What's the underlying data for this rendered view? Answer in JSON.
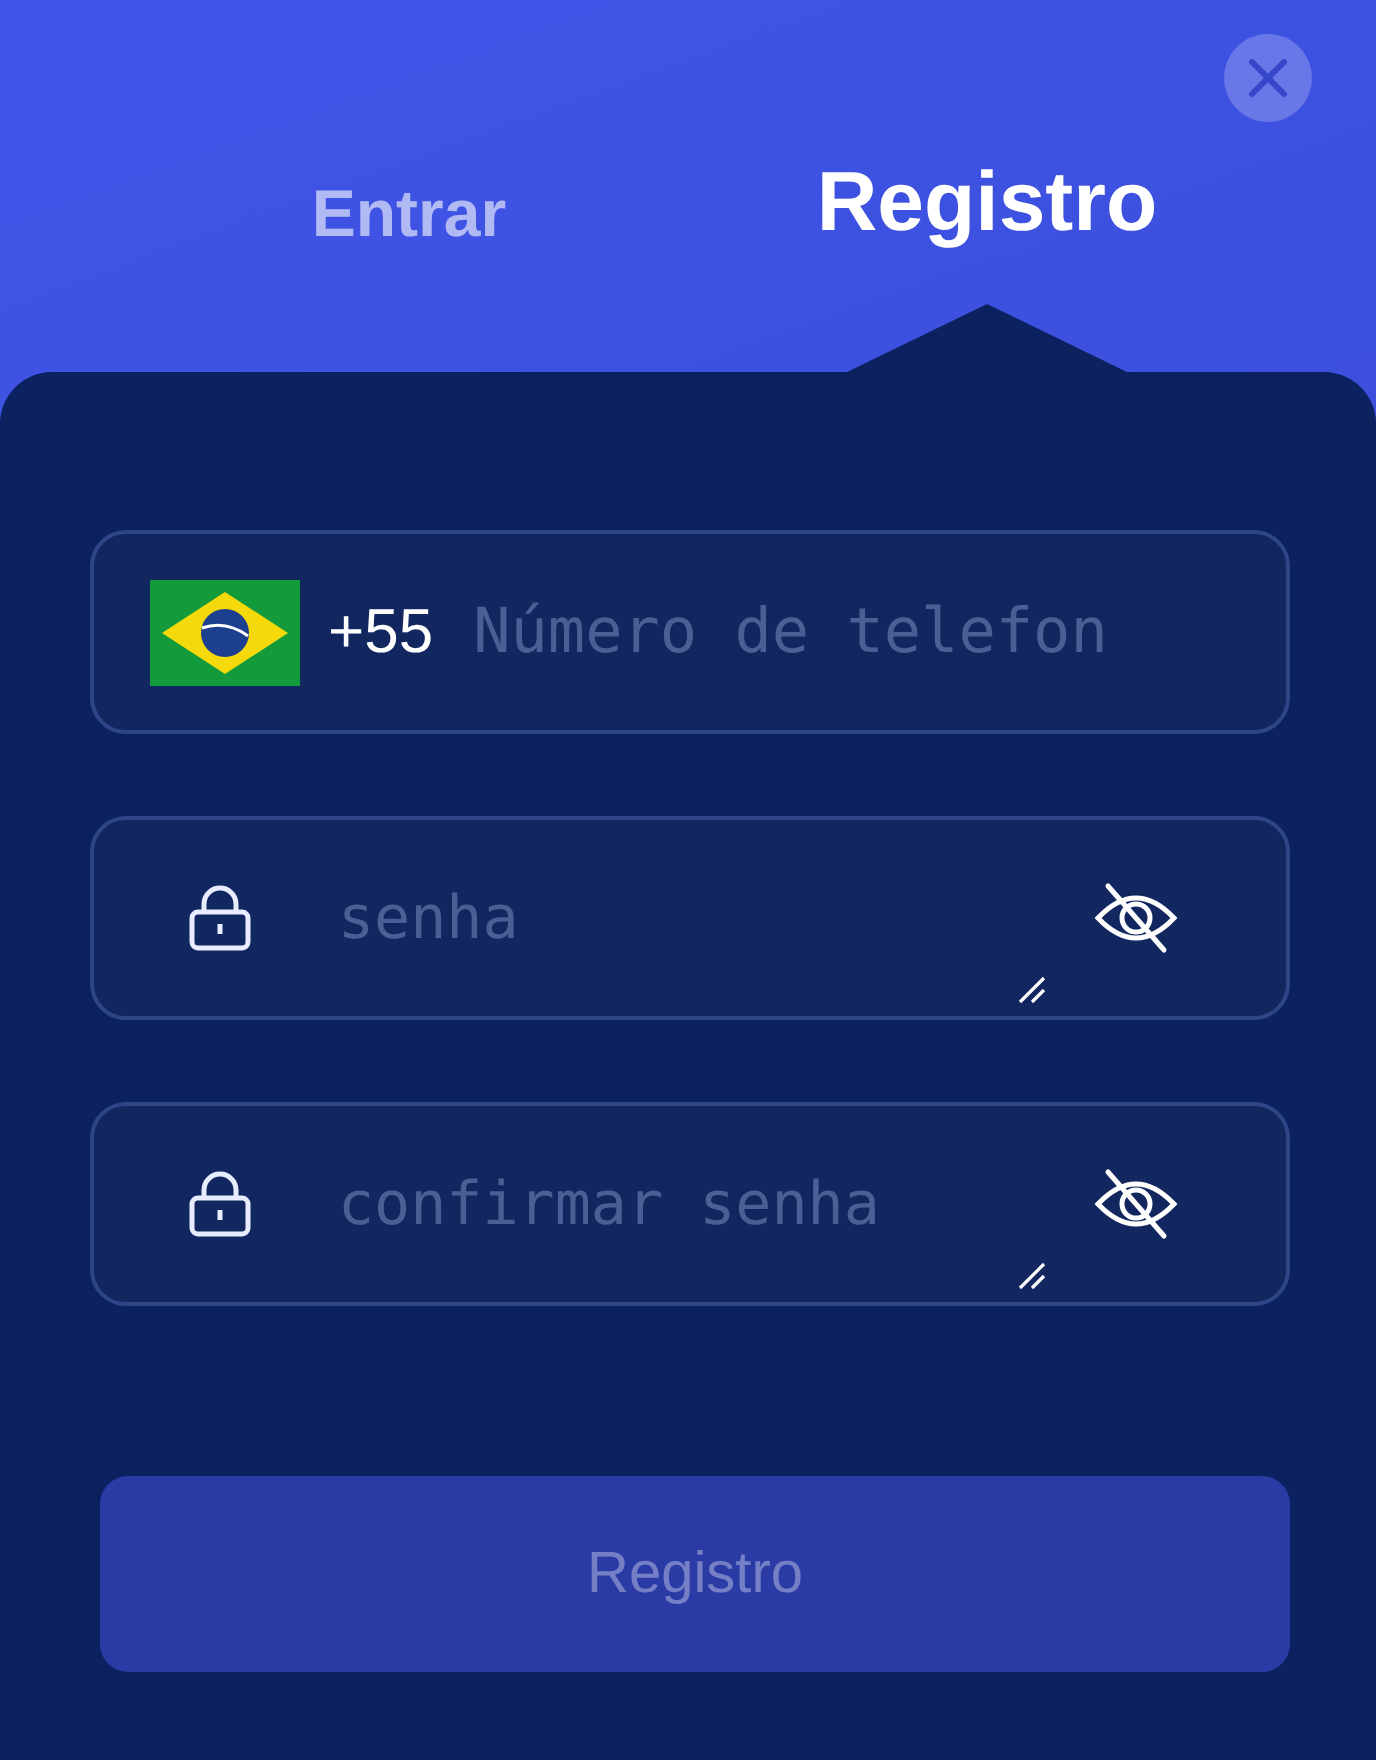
{
  "tabs": [
    {
      "label": "Entrar",
      "selected": false
    },
    {
      "label": "Registro",
      "selected": true
    }
  ],
  "fields": [
    {
      "kind": "phone",
      "prefix": "+55",
      "placeholder": "Número de telefon"
    },
    {
      "kind": "password",
      "placeholder": "senha",
      "masked": true
    },
    {
      "kind": "password",
      "placeholder": "confirmar senha",
      "masked": true
    }
  ],
  "submit": {
    "label": "Registro",
    "disabled": true
  }
}
